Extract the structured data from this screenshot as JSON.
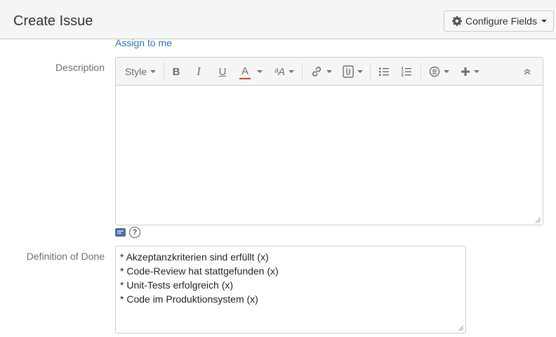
{
  "dialog": {
    "title": "Create Issue",
    "configure_fields_label": "Configure Fields"
  },
  "assignee": {
    "assign_to_me_label": "Assign to me"
  },
  "description": {
    "label": "Description",
    "toolbar": {
      "style_label": "Style",
      "bold_glyph": "B",
      "italic_glyph": "I",
      "underline_glyph": "U",
      "text_color_glyph": "A",
      "text_color": "#d04437",
      "text_effects_glyph": "ᵃA"
    },
    "value": ""
  },
  "definition_of_done": {
    "label": "Definition of Done",
    "lines": [
      "* Akzeptanzkriterien sind erfüllt (x)",
      "* Code-Review hat stattgefunden (x)",
      "* Unit-Tests erfolgreich (x)",
      "* Code im Produktionsystem (x)"
    ]
  },
  "icons": {
    "help_glyph": "?"
  }
}
